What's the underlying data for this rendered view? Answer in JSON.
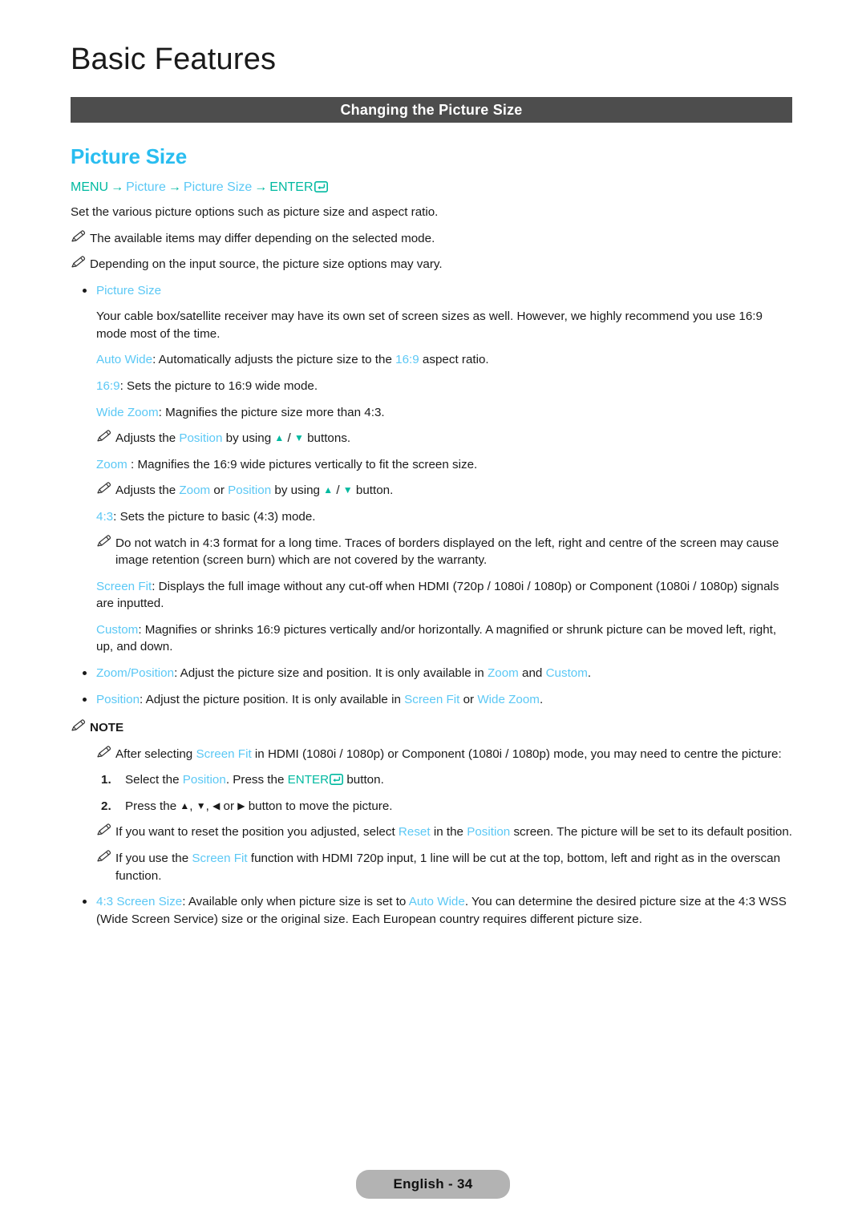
{
  "header": {
    "chapter_title": "Basic Features",
    "section_bar_title": "Changing the Picture Size"
  },
  "colors": {
    "accent_cyan": "#5bc8f5",
    "heading_cyan": "#29bdf0",
    "accent_teal": "#00b9a0",
    "bar_gray": "#4d4d4d",
    "footer_gray": "#b3b3b3"
  },
  "main": {
    "heading": "Picture Size",
    "menu_path": {
      "menu": "MENU",
      "arrow": "→",
      "item1": "Picture",
      "item2": "Picture Size",
      "enter": "ENTER",
      "enter_icon": "enter-return-icon"
    },
    "intro": "Set the various picture options such as picture size and aspect ratio.",
    "notes_top": [
      "The available items may differ depending on the selected mode.",
      "Depending on the input source, the picture size options may vary."
    ],
    "picture_size_bullet": "Picture Size",
    "cable_note": "Your cable box/satellite receiver may have its own set of screen sizes as well. However, we highly recommend you use 16:9 mode most of the time.",
    "options": {
      "auto_wide": {
        "term": "Auto Wide",
        "text_a": ": Automatically adjusts the picture size to the ",
        "ratio": "16:9",
        "text_b": " aspect ratio."
      },
      "sixteen_nine": {
        "term": "16:9",
        "text": ": Sets the picture to 16:9 wide mode."
      },
      "wide_zoom": {
        "term": "Wide Zoom",
        "text": ": Magnifies the picture size more than 4:3."
      },
      "wide_zoom_note": {
        "lead": "Adjusts the ",
        "term": "Position",
        "mid": " by using ",
        "up": "▲",
        "slash": " / ",
        "down": "▼",
        "tail": " buttons."
      },
      "zoom": {
        "term": "Zoom",
        "text": " : Magnifies the 16:9 wide pictures vertically to fit the screen size."
      },
      "zoom_note": {
        "lead": "Adjusts the ",
        "term1": "Zoom",
        "or": " or ",
        "term2": "Position",
        "mid": " by using ",
        "up": "▲",
        "slash": " / ",
        "down": "▼",
        "tail": " button."
      },
      "four_three": {
        "term": "4:3",
        "text": ": Sets the picture to basic (4:3) mode."
      },
      "four_three_warning": "Do not watch in 4:3 format for a long time. Traces of borders displayed on the left, right and centre of the screen may cause image retention (screen burn) which are not covered by the warranty.",
      "screen_fit": {
        "term": "Screen Fit",
        "text": ": Displays the full image without any cut-off when HDMI (720p / 1080i / 1080p) or Component (1080i / 1080p) signals are inputted."
      },
      "custom": {
        "term": "Custom",
        "text": ": Magnifies or shrinks 16:9 pictures vertically and/or horizontally. A magnified or shrunk picture can be moved left, right, up, and down."
      }
    },
    "bullets": {
      "zoom_position": {
        "term": "Zoom/Position",
        "text_a": ": Adjust the picture size and position. It is only available in ",
        "term2": "Zoom",
        "text_b": " and ",
        "term3": "Custom",
        "text_c": "."
      },
      "position": {
        "term": "Position",
        "text_a": ": Adjust the picture position. It is only available in ",
        "term2": "Screen Fit",
        "text_b": " or ",
        "term3": "Wide Zoom",
        "text_c": "."
      }
    },
    "note_heading": "NOTE",
    "note_items": {
      "screen_fit_centre": {
        "lead": "After selecting ",
        "term": "Screen Fit",
        "tail": " in HDMI (1080i / 1080p) or Component (1080i / 1080p) mode, you may need to centre the picture:"
      },
      "steps": [
        {
          "num": "1.",
          "lead": "Select the ",
          "term": "Position",
          "mid": ". Press the ",
          "enter": "ENTER",
          "tail": " button."
        },
        {
          "num": "2.",
          "lead": "Press the ",
          "up": "▲",
          "sep1": ", ",
          "down": "▼",
          "sep2": ", ",
          "left": "◀",
          "or": " or ",
          "right": "▶",
          "tail": " button to move the picture."
        }
      ],
      "reset": {
        "lead": "If you want to reset the position you adjusted, select ",
        "term": "Reset",
        "mid": " in the ",
        "term2": "Position",
        "tail": " screen. The picture will be set to its default position."
      },
      "overscan": {
        "lead": "If you use the ",
        "term": "Screen Fit",
        "tail": " function with HDMI 720p input, 1 line will be cut at the top, bottom, left and right as in the overscan function."
      }
    },
    "screen_size_bullet": {
      "term": "4:3 Screen Size",
      "text_a": ": Available only when picture size is set to ",
      "term2": "Auto Wide",
      "text_b": ". You can determine the desired picture size at the 4:3 WSS (Wide Screen Service) size or the original size. Each European country requires different picture size."
    }
  },
  "footer": {
    "page_label": "English - 34"
  }
}
